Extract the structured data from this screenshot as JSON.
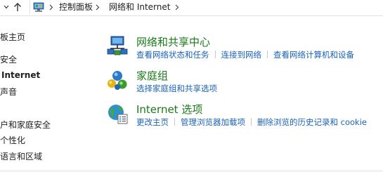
{
  "breadcrumb": {
    "items": [
      "控制面板",
      "网络和 Internet"
    ]
  },
  "sidebar": {
    "items": [
      {
        "label": "板主页"
      },
      {
        "label": "安全"
      },
      {
        "label": "Internet",
        "selected": true
      },
      {
        "label": "声音"
      },
      {
        "label": "户和家庭安全"
      },
      {
        "label": "个性化"
      },
      {
        "label": "语言和区域"
      }
    ]
  },
  "sections": [
    {
      "title": "网络和共享中心",
      "icon": "network-sharing-center-icon",
      "links": [
        "查看网络状态和任务",
        "连接到网络",
        "查看网络计算机和设备"
      ]
    },
    {
      "title": "家庭组",
      "icon": "homegroup-icon",
      "links": [
        "选择家庭组和共享选项"
      ]
    },
    {
      "title": "Internet 选项",
      "icon": "internet-options-icon",
      "links": [
        "更改主页",
        "管理浏览器加载项",
        "删除浏览的历史记录和 cookie"
      ]
    }
  ],
  "colors": {
    "title_green": "#1a7a1a",
    "link_blue": "#1b62b8"
  }
}
